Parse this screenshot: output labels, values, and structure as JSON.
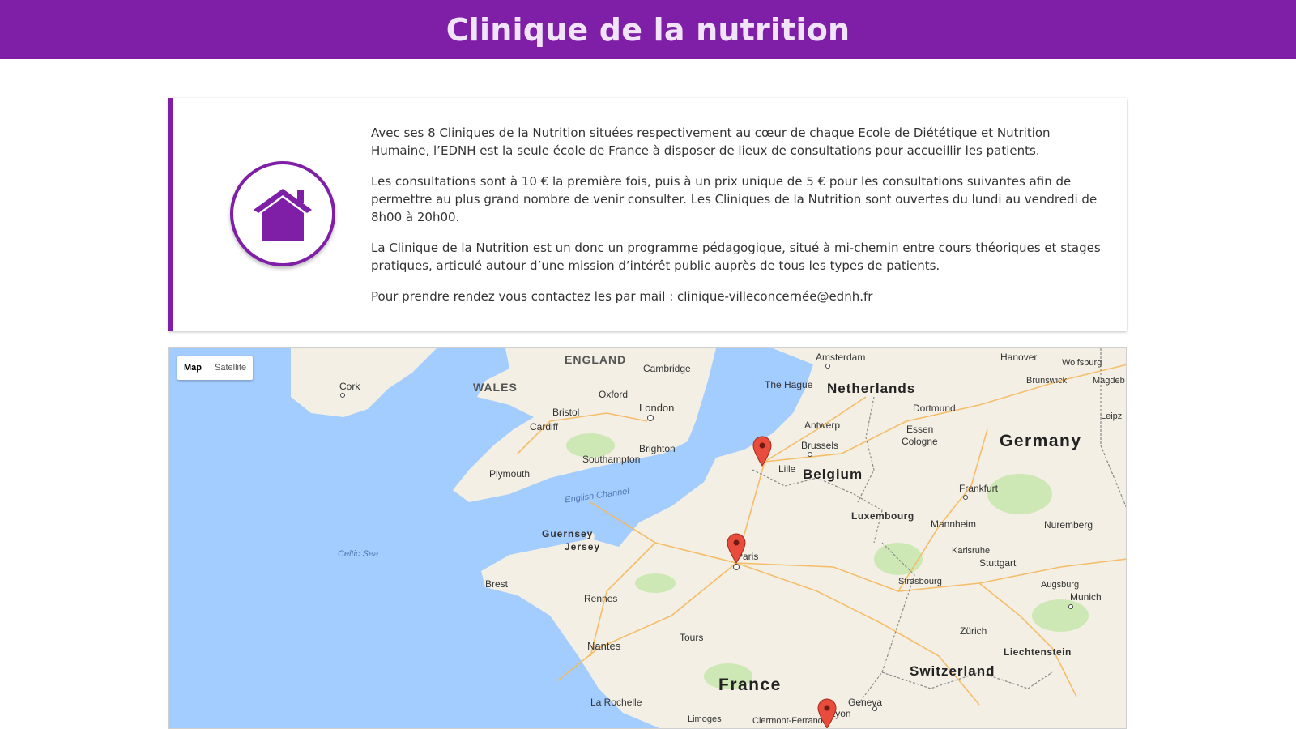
{
  "header": {
    "title": "Clinique de la nutrition"
  },
  "card": {
    "icon": "house-icon",
    "paragraphs": [
      "Avec ses 8 Cliniques de la Nutrition situées respectivement au cœur de chaque Ecole de Diététique et Nutrition Humaine, l’EDNH est la seule école de France à disposer de lieux de consultations pour accueillir les patients.",
      "Les consultations sont à 10 € la première fois, puis à un prix unique de 5 € pour les consultations suivantes afin de permettre au plus grand nombre de venir consulter. Les Cliniques de la Nutrition sont ouvertes du lundi au vendredi de 8h00 à 20h00.",
      "La Clinique de la Nutrition est un donc un programme pédagogique, situé à mi-chemin entre cours théoriques et stages pratiques, articulé autour d’une mission d’intérêt public auprès de tous les types de patients.",
      "Pour prendre rendez vous contactez les par mail : clinique-villeconcernée@ednh.fr"
    ]
  },
  "map": {
    "map_type_control": {
      "map_label": "Map",
      "satellite_label": "Satellite",
      "selected": "Map"
    },
    "colors": {
      "water": "#a3ccff",
      "land": "#f3efe4",
      "marker": "#e74c3c",
      "accent": "#7f1fa8"
    },
    "labels": {
      "england": "ENGLAND",
      "wales": "WALES",
      "cork": "Cork",
      "cambridge": "Cambridge",
      "oxford": "Oxford",
      "london": "London",
      "bristol": "Bristol",
      "cardiff": "Cardiff",
      "brighton": "Brighton",
      "southampton": "Southampton",
      "plymouth": "Plymouth",
      "english_channel": "English Channel",
      "celtic_sea": "Celtic Sea",
      "guernsey": "Guernsey",
      "jersey": "Jersey",
      "brest": "Brest",
      "rennes": "Rennes",
      "nantes": "Nantes",
      "tours": "Tours",
      "la_rochelle": "La Rochelle",
      "limoges": "Limoges",
      "clermont": "Clermont-Ferrand",
      "france": "France",
      "paris": "Paris",
      "lille": "Lille",
      "amsterdam": "Amsterdam",
      "the_hague": "The Hague",
      "netherlands": "Netherlands",
      "antwerp": "Antwerp",
      "brussels": "Brussels",
      "belgium": "Belgium",
      "luxembourg": "Luxembourg",
      "dortmund": "Dortmund",
      "essen": "Essen",
      "cologne": "Cologne",
      "germany": "Germany",
      "frankfurt": "Frankfurt",
      "mannheim": "Mannheim",
      "karlsruhe": "Karlsruhe",
      "stuttgart": "Stuttgart",
      "strasbourg": "Strasbourg",
      "nuremberg": "Nuremberg",
      "augsburg": "Augsburg",
      "munich": "Munich",
      "hanover": "Hanover",
      "wolfsburg": "Wolfsburg",
      "brunswick": "Brunswick",
      "magdeburg": "Magdeb",
      "leipzig": "Leipz",
      "zurich": "Zürich",
      "liechtenstein": "Liechtenstein",
      "switzerland": "Switzerland",
      "geneva": "Geneva",
      "lyon": "Lyon"
    },
    "markers": [
      "Lille",
      "Paris",
      "Lyon"
    ]
  }
}
